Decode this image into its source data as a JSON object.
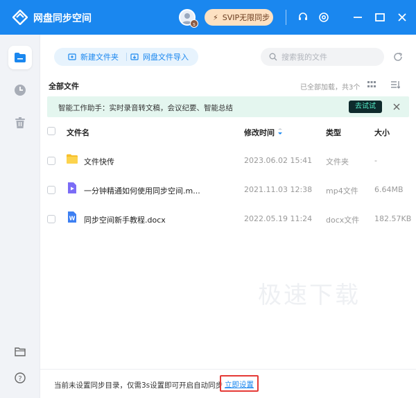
{
  "titlebar": {
    "app_title": "网盘同步空间",
    "avatar_badge": "s",
    "svip_label": "SVIP无限同步",
    "background": "#1a87ef"
  },
  "sidebar": {
    "items": [
      {
        "icon": "folder-icon",
        "active": true
      },
      {
        "icon": "clock-icon",
        "active": false
      },
      {
        "icon": "trash-icon",
        "active": false
      },
      {
        "icon": "folder-outline-icon",
        "active": false
      },
      {
        "icon": "help-icon",
        "active": false
      }
    ]
  },
  "toolbar": {
    "new_folder_label": "新建文件夹",
    "import_label": "网盘文件导入",
    "search_placeholder": "搜索我的文件"
  },
  "section": {
    "title": "全部文件",
    "load_status": "已全部加载，共3个"
  },
  "banner": {
    "text": "智能工作助手：实时录音转文稿，会议纪要、智能总结",
    "button_label": "去试试"
  },
  "table": {
    "headers": {
      "name": "文件名",
      "modified": "修改时间",
      "type": "类型",
      "size": "大小"
    },
    "rows": [
      {
        "icon": "folder-icon",
        "name": "文件快传",
        "modified": "2023.06.02 15:41",
        "type": "文件夹",
        "size": "-"
      },
      {
        "icon": "video-file-icon",
        "name": "一分钟精通如何使用同步空间.m...",
        "modified": "2021.11.03 12:38",
        "type": "mp4文件",
        "size": "6.64MB"
      },
      {
        "icon": "word-file-icon",
        "name": "同步空间新手教程.docx",
        "modified": "2022.05.19 11:24",
        "type": "docx文件",
        "size": "182.57KB"
      }
    ]
  },
  "watermark": "极速下载",
  "footer": {
    "text": "当前未设置同步目录，仅需3s设置即可开启自动同步",
    "link_label": "立即设置"
  }
}
